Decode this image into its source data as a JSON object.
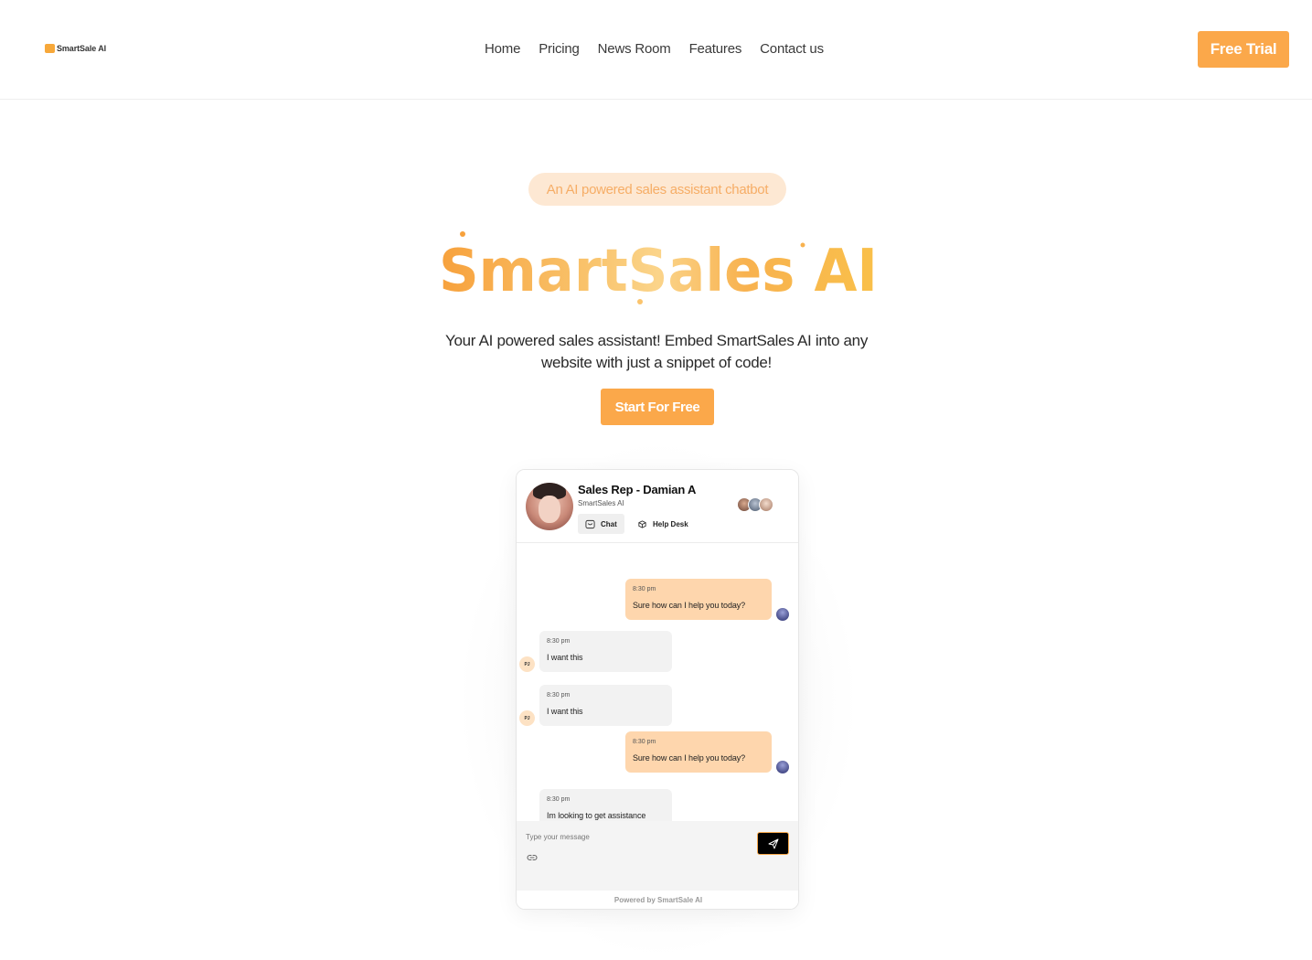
{
  "header": {
    "logo_text": "SmartSale AI",
    "nav": [
      "Home",
      "Pricing",
      "News Room",
      "Features",
      "Contact us"
    ],
    "cta_label": "Free Trial"
  },
  "hero": {
    "tagline": "An AI powered sales assistant chatbot",
    "brand": "SmartSales AI",
    "subtitle_line1": "Your AI powered sales assistant! Embed SmartSales AI into any",
    "subtitle_line2": "website with just a snippet of code!",
    "cta_label": "Start For Free"
  },
  "chat": {
    "rep_name": "Sales Rep - Damian A",
    "company": "SmartSales AI",
    "tabs": [
      "Chat",
      "Help Desk"
    ],
    "user_initials": "PJ",
    "messages": [
      {
        "from": "rep",
        "time": "8:30 pm",
        "text": "Sure how can I help you today?"
      },
      {
        "from": "user",
        "time": "8:30 pm",
        "text": "I want this"
      },
      {
        "from": "user",
        "time": "8:30 pm",
        "text": "I want this"
      },
      {
        "from": "rep",
        "time": "8:30 pm",
        "text": "Sure how can I help you today?"
      },
      {
        "from": "user",
        "time": "8:30 pm",
        "text": "Im looking to get assistance"
      }
    ],
    "input_placeholder": "Type your message",
    "powered_by": "Powered by SmartSale AI"
  },
  "colors": {
    "accent": "#fba84a",
    "pill_bg": "#fde8d3",
    "rep_bubble": "#fed6ad",
    "user_bubble": "#f2f2f2"
  }
}
